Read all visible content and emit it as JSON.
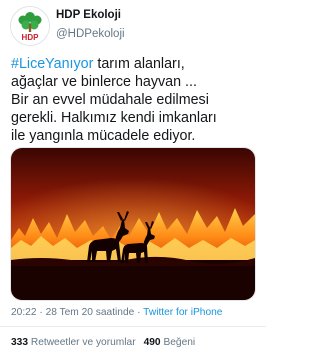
{
  "account": {
    "name": "HDP Ekoloji",
    "handle": "@HDPekoloji",
    "avatar_text": "HDP",
    "avatar_icon": "hdp-tree-logo-icon"
  },
  "tweet": {
    "hashtag": "#LiceYanıyor",
    "lines": [
      " tarım alanları,",
      "ağaçlar ve binlerce hayvan ...",
      "Bir an evvel müdahale edilmesi",
      "gerekli. Halkımız kendi imkanları",
      "ile yangınla mücadele ediyor."
    ]
  },
  "media": {
    "description_icon": "fire-deer-photo"
  },
  "meta": {
    "time": "20:22",
    "sep1": " · ",
    "date": "28 Tem 20 saatinde",
    "sep2": " · ",
    "source": "Twitter for iPhone"
  },
  "stats": {
    "retweets_count": "333",
    "retweets_label": "Retweetler ve yorumlar",
    "likes_count": "490",
    "likes_label": "Beğeni"
  },
  "colors": {
    "link": "#1b95e0",
    "text": "#14171a",
    "secondary": "#657786",
    "avatar_green": "#2f9d3e",
    "avatar_red": "#c8202b"
  }
}
